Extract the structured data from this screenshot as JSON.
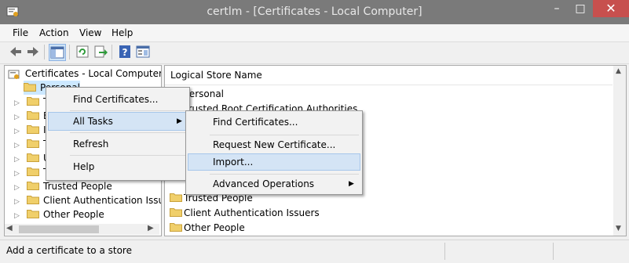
{
  "window": {
    "title": "certlm - [Certificates - Local Computer]",
    "minimize": "–",
    "maximize": "□",
    "close": "✕"
  },
  "menubar": [
    "File",
    "Action",
    "View",
    "Help"
  ],
  "toolbar": {
    "icons": [
      "back-icon",
      "forward-icon",
      "show-hide-tree-icon",
      "refresh-icon",
      "export-list-icon",
      "help-icon",
      "properties-icon"
    ]
  },
  "tree": {
    "root": "Certificates - Local Computer",
    "items": [
      {
        "label": "Personal"
      },
      {
        "label": "T"
      },
      {
        "label": "E"
      },
      {
        "label": "In"
      },
      {
        "label": "T"
      },
      {
        "label": "U"
      },
      {
        "label": "T"
      },
      {
        "label": "Trusted People"
      },
      {
        "label": "Client Authentication Issue"
      },
      {
        "label": "Other People"
      }
    ]
  },
  "list": {
    "column": "Logical Store Name",
    "items": [
      {
        "label": "Personal"
      },
      {
        "label": "Trusted Root Certification Authorities"
      },
      {
        "label": "T"
      },
      {
        "label": "Trusted People"
      },
      {
        "label": "Client Authentication Issuers"
      },
      {
        "label": "Other People"
      }
    ]
  },
  "context_menu": {
    "items": [
      "Find Certificates...",
      "All Tasks",
      "Refresh",
      "Help"
    ]
  },
  "submenu": {
    "items": [
      "Find Certificates...",
      "Request New Certificate...",
      "Import...",
      "Advanced Operations"
    ]
  },
  "statusbar": {
    "text": "Add a certificate to a store"
  },
  "colors": {
    "titlebar": "#7a7a7a",
    "close": "#c7504e",
    "highlight": "#d4e4f5",
    "folder": "#f0cf6a"
  }
}
